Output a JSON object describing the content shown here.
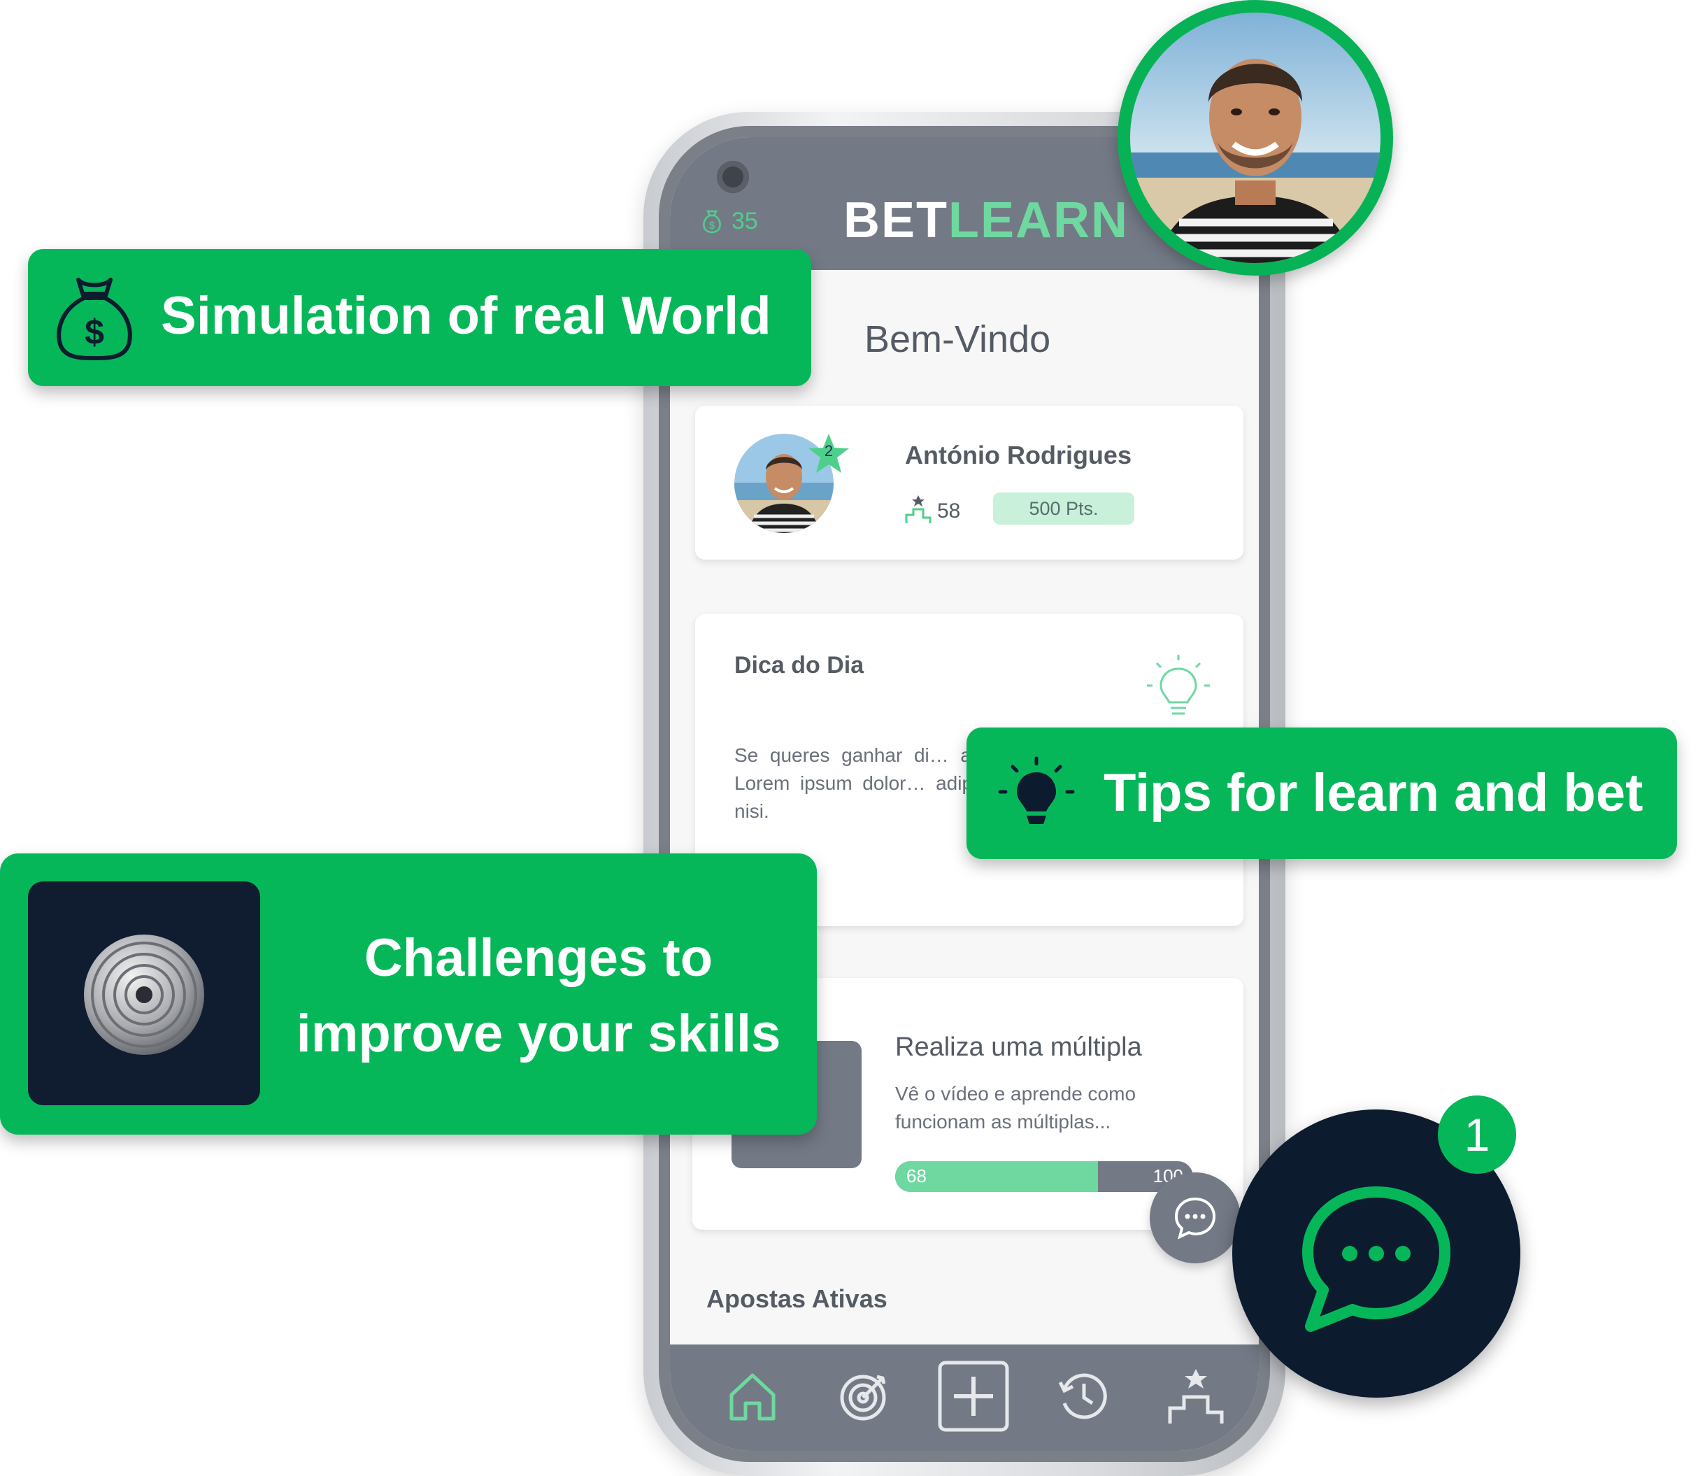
{
  "app": {
    "brand_part1": "BET",
    "brand_part2": "LEARN",
    "coins": "35"
  },
  "home": {
    "welcome": "Bem-Vindo"
  },
  "profile": {
    "name": "António Rodrigues",
    "level": "2",
    "rank": "58",
    "points": "500 Pts."
  },
  "tip": {
    "title": "Dica do Dia",
    "text": "Se queres ganhar di… apostas, trabalha para e… Lorem ipsum dolor… adipiscing elit. Vivamu… …ue nisi."
  },
  "challenge": {
    "title": "Realiza uma múltipla",
    "description": "Vê o vídeo e aprende como funcionam as múltiplas...",
    "progress_value": 68,
    "progress_label": "68",
    "progress_max": "100"
  },
  "active_bets": {
    "title": "Apostas Ativas"
  },
  "nav": {
    "items": [
      "home-icon",
      "target-icon",
      "plus-icon",
      "history-icon",
      "ranking-icon"
    ],
    "active": "home-icon"
  },
  "banners": {
    "simulation": "Simulation of real World",
    "tips": "Tips for learn and bet",
    "challenges": "Challenges to improve your skills"
  },
  "chat": {
    "badge": "1"
  },
  "colors": {
    "brand_green": "#06b75a",
    "accent_green": "#6fd8a0",
    "appbar_grey": "#737a86",
    "dark_navy": "#0d1b2f"
  }
}
